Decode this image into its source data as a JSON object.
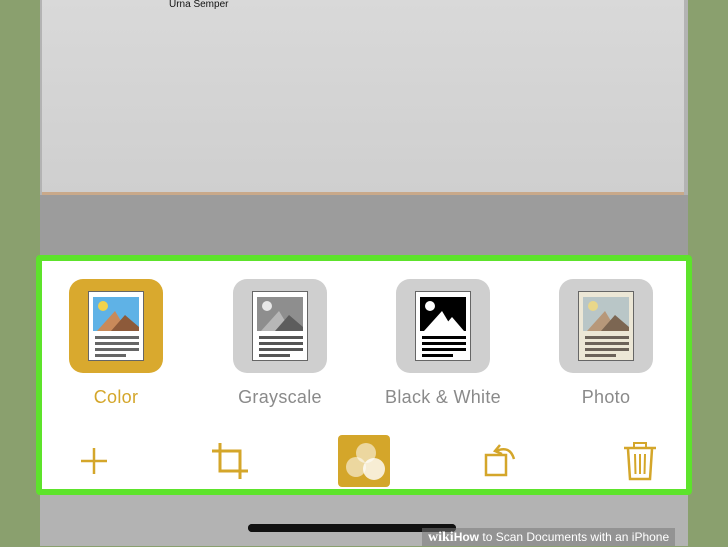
{
  "document": {
    "signature_name": "Urna Semper"
  },
  "filters": [
    {
      "label": "Color",
      "selected": true
    },
    {
      "label": "Grayscale",
      "selected": false
    },
    {
      "label": "Black & White",
      "selected": false
    },
    {
      "label": "Photo",
      "selected": false
    }
  ],
  "toolbar": {
    "icons": [
      "plus-icon",
      "crop-icon",
      "filters-icon",
      "rotate-icon",
      "trash-icon"
    ]
  },
  "colors": {
    "accent": "#d4a62a",
    "highlight_border": "#5de32b",
    "background": "#8aa06e"
  },
  "watermark": {
    "brand": "wiki",
    "title_bold": "How",
    "title_rest": " to Scan Documents with an iPhone"
  }
}
